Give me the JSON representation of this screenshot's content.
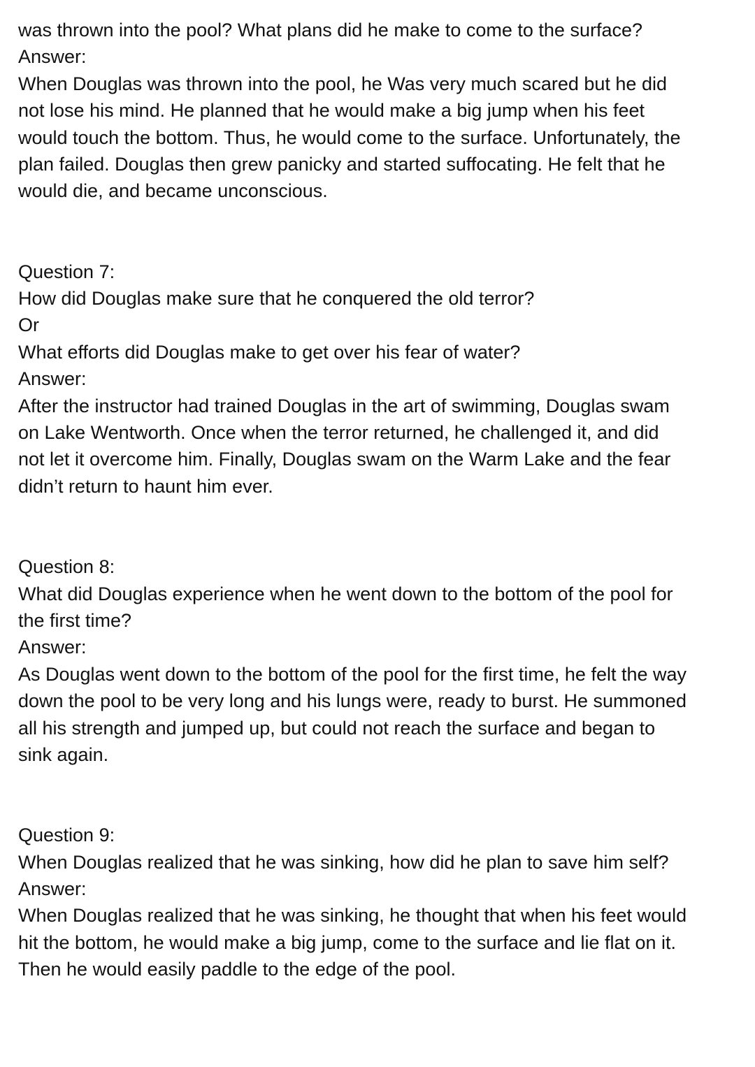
{
  "blocks": [
    {
      "lines": [
        "was thrown into the pool? What plans did he make to come to the surface?",
        "Answer:",
        "When Douglas was thrown into the pool, he Was very much scared but he did",
        "not lose his mind. He planned that he would make a big jump when his feet",
        "would touch the bottom. Thus, he would come to the surface. Unfortunately, the",
        "plan failed. Douglas then grew panicky and started suffocating. He felt that he",
        "would die, and became unconscious."
      ]
    },
    {
      "lines": [
        "Question 7:",
        "How did Douglas make sure that he conquered the old terror?",
        "Or",
        "What efforts did Douglas make to get over his fear of water?",
        "Answer:",
        "After the instructor had trained Douglas in the art of swimming, Douglas swam",
        "on Lake Wentworth. Once when the terror returned, he challenged it, and did",
        "not let it overcome him. Finally, Douglas swam on the Warm Lake and the fear",
        "didn’t return to haunt him ever."
      ]
    },
    {
      "lines": [
        "Question 8:",
        "What did Douglas experience when he went down to the bottom of the pool for",
        "the first time?",
        "Answer:",
        "As Douglas went down to the bottom of the pool for the first time, he felt the way",
        "down the pool to be very long and his lungs were, ready to burst. He summoned",
        "all his strength and jumped up, but could not reach the surface and began to",
        "sink again."
      ]
    },
    {
      "lines": [
        "Question 9:",
        "When Douglas realized that he was sinking, how did he plan to save him self?",
        "Answer:",
        "When Douglas realized that he was sinking, he thought that when his feet would",
        "hit the bottom, he would make a big jump, come to the surface and lie flat on it.",
        "Then he would easily paddle to the edge of the pool."
      ]
    }
  ]
}
